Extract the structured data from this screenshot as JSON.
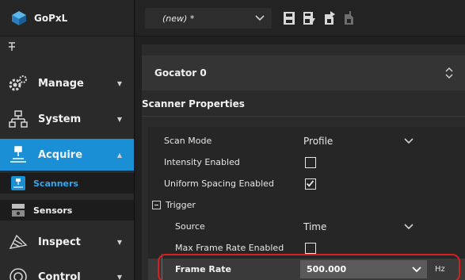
{
  "app": {
    "name": "GoPxL"
  },
  "sidebar": {
    "items": [
      {
        "label": "Manage",
        "expanded": false
      },
      {
        "label": "System",
        "expanded": false
      },
      {
        "label": "Acquire",
        "expanded": true
      },
      {
        "label": "Inspect",
        "expanded": false
      },
      {
        "label": "Control",
        "expanded": false
      }
    ],
    "acquire_sub": [
      {
        "label": "Scanners",
        "active": true
      },
      {
        "label": "Sensors",
        "active": false
      }
    ]
  },
  "topbar": {
    "job_value": "(new) *"
  },
  "device": {
    "label": "Gocator 0"
  },
  "section": {
    "title": "Scanner Properties"
  },
  "properties": {
    "scan_mode": {
      "label": "Scan Mode",
      "value": "Profile"
    },
    "intensity_enabled": {
      "label": "Intensity Enabled",
      "checked": false
    },
    "uniform_spacing": {
      "label": "Uniform Spacing Enabled",
      "checked": true
    },
    "trigger": {
      "label": "Trigger",
      "source": {
        "label": "Source",
        "value": "Time"
      },
      "max_frame_rate": {
        "label": "Max Frame Rate Enabled",
        "checked": false
      },
      "frame_rate": {
        "label": "Frame Rate",
        "value": "500.000",
        "unit": "Hz"
      }
    }
  },
  "colors": {
    "accent": "#1a8fd6",
    "highlight": "#d81e1e",
    "active_sub": "#2ea8f0"
  },
  "icons": [
    "gopxl-logo-icon",
    "pin-icon",
    "gears-icon",
    "network-icon",
    "scanner-icon",
    "scanners-icon",
    "sensor-icon",
    "inspect-icon",
    "control-icon",
    "save-icon",
    "save-as-icon",
    "export-icon",
    "import-icon",
    "chevron-down-icon",
    "up-down-icon"
  ]
}
